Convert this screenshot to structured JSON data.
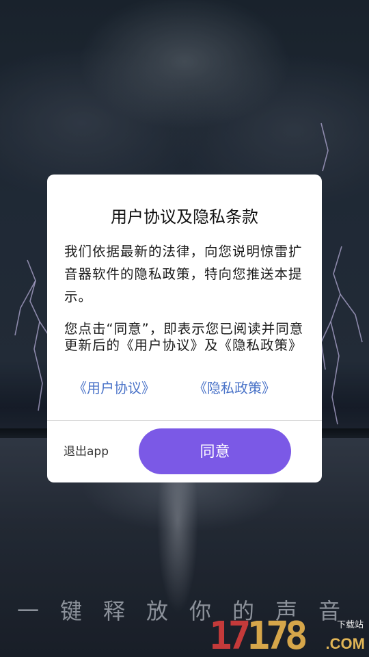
{
  "background": {
    "slogan": "一键释放你的声音"
  },
  "watermark": {
    "digits_red": "17",
    "digits_gold": "178",
    "domain": ".COM",
    "site_label": "下载站"
  },
  "dialog": {
    "title": "用户协议及隐私条款",
    "paragraph1": "我们依据最新的法律，向您说明惊雷扩音器软件的隐私政策，特向您推送本提示。",
    "paragraph2": "您点击“同意”，即表示您已阅读并同意更新后的《用户协议》及《隐私政策》",
    "link_user_agreement": "《用户协议》",
    "link_privacy_policy": "《隐私政策》",
    "exit_label": "退出app",
    "agree_label": "同意"
  },
  "colors": {
    "accent": "#7b59e6",
    "link": "#4a73c8",
    "dialog_bg": "#ffffff"
  }
}
